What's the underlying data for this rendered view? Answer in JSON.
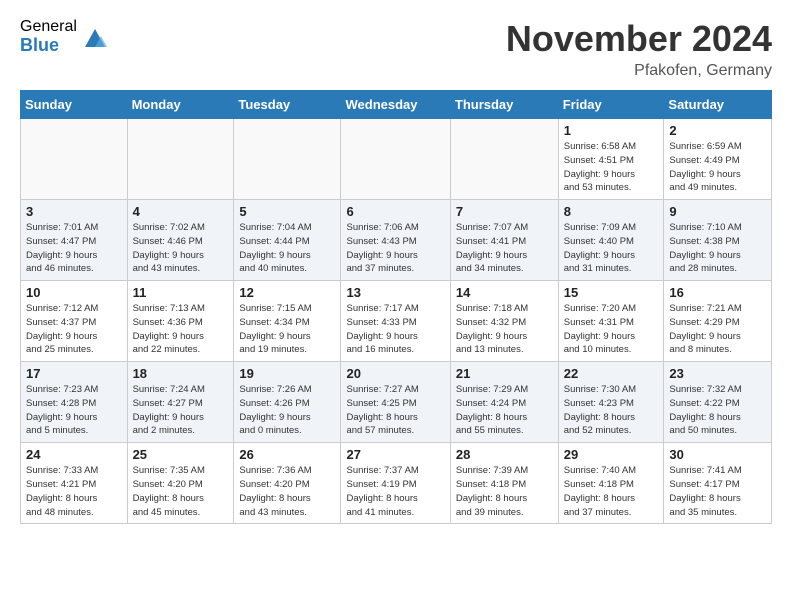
{
  "logo": {
    "general": "General",
    "blue": "Blue"
  },
  "title": "November 2024",
  "location": "Pfakofen, Germany",
  "days_of_week": [
    "Sunday",
    "Monday",
    "Tuesday",
    "Wednesday",
    "Thursday",
    "Friday",
    "Saturday"
  ],
  "weeks": [
    [
      {
        "day": "",
        "info": "",
        "empty": true
      },
      {
        "day": "",
        "info": "",
        "empty": true
      },
      {
        "day": "",
        "info": "",
        "empty": true
      },
      {
        "day": "",
        "info": "",
        "empty": true
      },
      {
        "day": "",
        "info": "",
        "empty": true
      },
      {
        "day": "1",
        "info": "Sunrise: 6:58 AM\nSunset: 4:51 PM\nDaylight: 9 hours\nand 53 minutes."
      },
      {
        "day": "2",
        "info": "Sunrise: 6:59 AM\nSunset: 4:49 PM\nDaylight: 9 hours\nand 49 minutes."
      }
    ],
    [
      {
        "day": "3",
        "info": "Sunrise: 7:01 AM\nSunset: 4:47 PM\nDaylight: 9 hours\nand 46 minutes."
      },
      {
        "day": "4",
        "info": "Sunrise: 7:02 AM\nSunset: 4:46 PM\nDaylight: 9 hours\nand 43 minutes."
      },
      {
        "day": "5",
        "info": "Sunrise: 7:04 AM\nSunset: 4:44 PM\nDaylight: 9 hours\nand 40 minutes."
      },
      {
        "day": "6",
        "info": "Sunrise: 7:06 AM\nSunset: 4:43 PM\nDaylight: 9 hours\nand 37 minutes."
      },
      {
        "day": "7",
        "info": "Sunrise: 7:07 AM\nSunset: 4:41 PM\nDaylight: 9 hours\nand 34 minutes."
      },
      {
        "day": "8",
        "info": "Sunrise: 7:09 AM\nSunset: 4:40 PM\nDaylight: 9 hours\nand 31 minutes."
      },
      {
        "day": "9",
        "info": "Sunrise: 7:10 AM\nSunset: 4:38 PM\nDaylight: 9 hours\nand 28 minutes."
      }
    ],
    [
      {
        "day": "10",
        "info": "Sunrise: 7:12 AM\nSunset: 4:37 PM\nDaylight: 9 hours\nand 25 minutes."
      },
      {
        "day": "11",
        "info": "Sunrise: 7:13 AM\nSunset: 4:36 PM\nDaylight: 9 hours\nand 22 minutes."
      },
      {
        "day": "12",
        "info": "Sunrise: 7:15 AM\nSunset: 4:34 PM\nDaylight: 9 hours\nand 19 minutes."
      },
      {
        "day": "13",
        "info": "Sunrise: 7:17 AM\nSunset: 4:33 PM\nDaylight: 9 hours\nand 16 minutes."
      },
      {
        "day": "14",
        "info": "Sunrise: 7:18 AM\nSunset: 4:32 PM\nDaylight: 9 hours\nand 13 minutes."
      },
      {
        "day": "15",
        "info": "Sunrise: 7:20 AM\nSunset: 4:31 PM\nDaylight: 9 hours\nand 10 minutes."
      },
      {
        "day": "16",
        "info": "Sunrise: 7:21 AM\nSunset: 4:29 PM\nDaylight: 9 hours\nand 8 minutes."
      }
    ],
    [
      {
        "day": "17",
        "info": "Sunrise: 7:23 AM\nSunset: 4:28 PM\nDaylight: 9 hours\nand 5 minutes."
      },
      {
        "day": "18",
        "info": "Sunrise: 7:24 AM\nSunset: 4:27 PM\nDaylight: 9 hours\nand 2 minutes."
      },
      {
        "day": "19",
        "info": "Sunrise: 7:26 AM\nSunset: 4:26 PM\nDaylight: 9 hours\nand 0 minutes."
      },
      {
        "day": "20",
        "info": "Sunrise: 7:27 AM\nSunset: 4:25 PM\nDaylight: 8 hours\nand 57 minutes."
      },
      {
        "day": "21",
        "info": "Sunrise: 7:29 AM\nSunset: 4:24 PM\nDaylight: 8 hours\nand 55 minutes."
      },
      {
        "day": "22",
        "info": "Sunrise: 7:30 AM\nSunset: 4:23 PM\nDaylight: 8 hours\nand 52 minutes."
      },
      {
        "day": "23",
        "info": "Sunrise: 7:32 AM\nSunset: 4:22 PM\nDaylight: 8 hours\nand 50 minutes."
      }
    ],
    [
      {
        "day": "24",
        "info": "Sunrise: 7:33 AM\nSunset: 4:21 PM\nDaylight: 8 hours\nand 48 minutes."
      },
      {
        "day": "25",
        "info": "Sunrise: 7:35 AM\nSunset: 4:20 PM\nDaylight: 8 hours\nand 45 minutes."
      },
      {
        "day": "26",
        "info": "Sunrise: 7:36 AM\nSunset: 4:20 PM\nDaylight: 8 hours\nand 43 minutes."
      },
      {
        "day": "27",
        "info": "Sunrise: 7:37 AM\nSunset: 4:19 PM\nDaylight: 8 hours\nand 41 minutes."
      },
      {
        "day": "28",
        "info": "Sunrise: 7:39 AM\nSunset: 4:18 PM\nDaylight: 8 hours\nand 39 minutes."
      },
      {
        "day": "29",
        "info": "Sunrise: 7:40 AM\nSunset: 4:18 PM\nDaylight: 8 hours\nand 37 minutes."
      },
      {
        "day": "30",
        "info": "Sunrise: 7:41 AM\nSunset: 4:17 PM\nDaylight: 8 hours\nand 35 minutes."
      }
    ]
  ]
}
